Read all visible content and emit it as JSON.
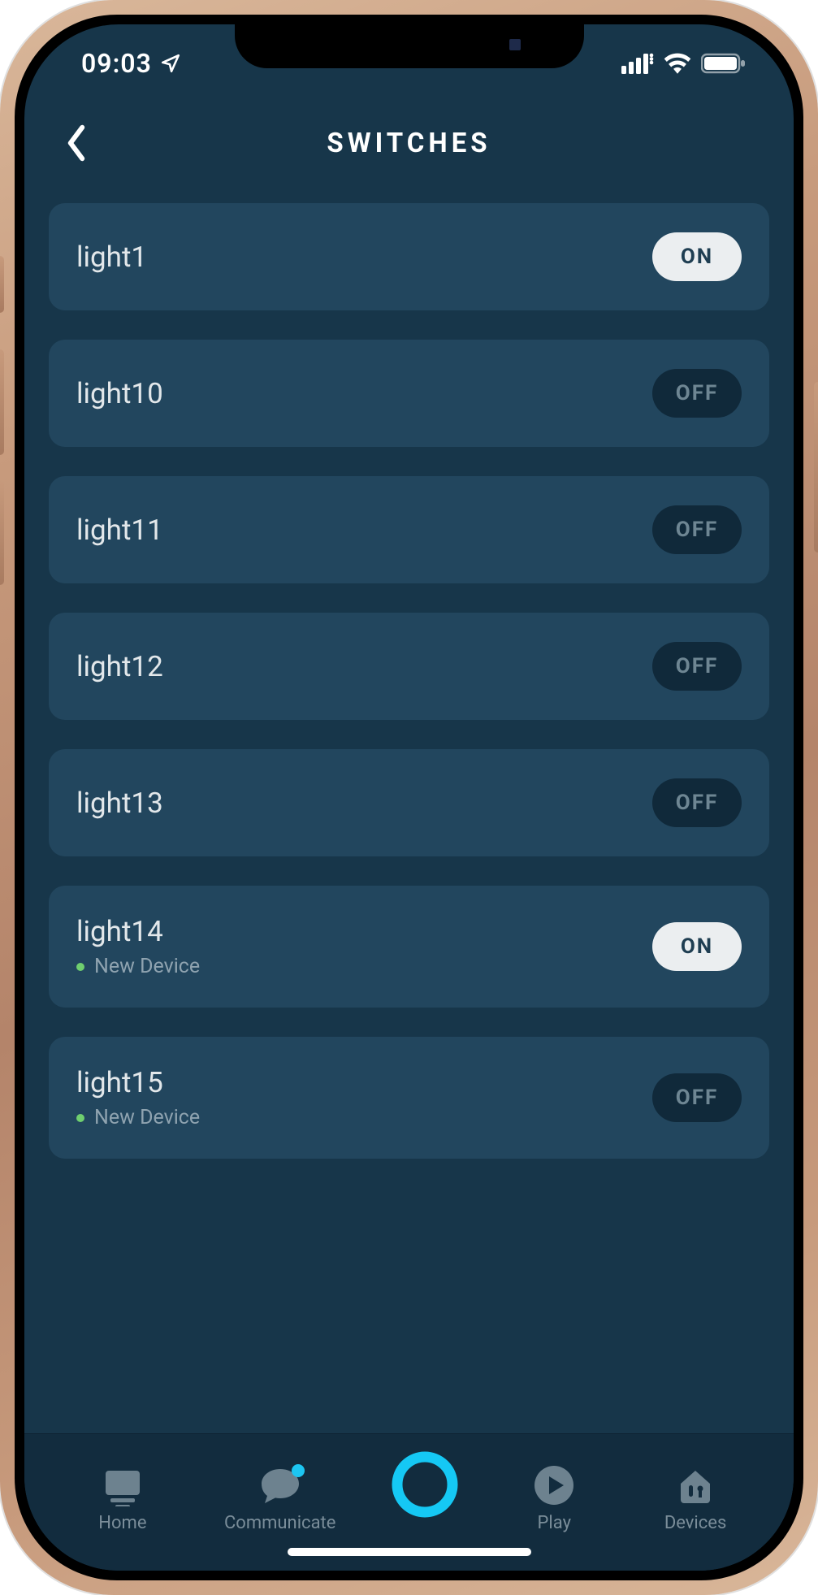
{
  "status": {
    "time": "09:03"
  },
  "header": {
    "title": "SWITCHES"
  },
  "switches": [
    {
      "name": "light1",
      "state": "ON",
      "is_on": true,
      "sub": null
    },
    {
      "name": "light10",
      "state": "OFF",
      "is_on": false,
      "sub": null
    },
    {
      "name": "light11",
      "state": "OFF",
      "is_on": false,
      "sub": null
    },
    {
      "name": "light12",
      "state": "OFF",
      "is_on": false,
      "sub": null
    },
    {
      "name": "light13",
      "state": "OFF",
      "is_on": false,
      "sub": null
    },
    {
      "name": "light14",
      "state": "ON",
      "is_on": true,
      "sub": "New Device"
    },
    {
      "name": "light15",
      "state": "OFF",
      "is_on": false,
      "sub": "New Device"
    }
  ],
  "tabs": {
    "home": "Home",
    "communicate": "Communicate",
    "play": "Play",
    "devices": "Devices"
  }
}
